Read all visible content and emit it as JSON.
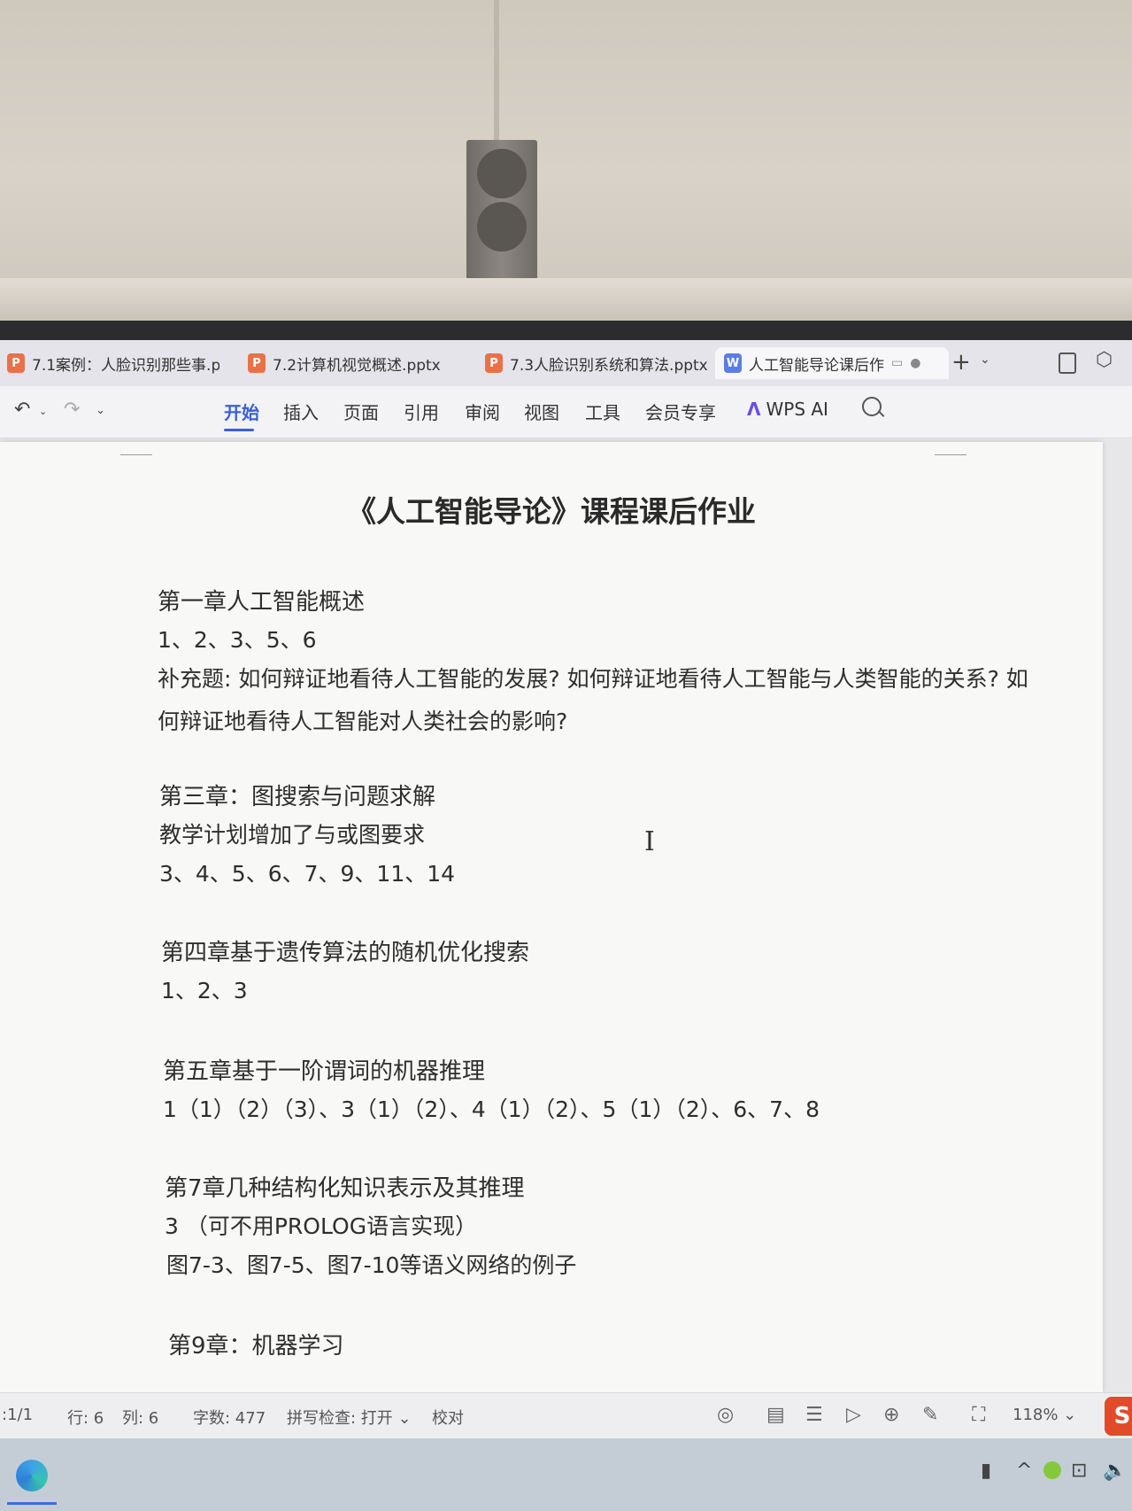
{
  "tabs": [
    {
      "badge": "P",
      "label": "7.1案例：人脸识别那些事.p"
    },
    {
      "badge": "P",
      "label": "7.2计算机视觉概述.pptx"
    },
    {
      "badge": "P",
      "label": "7.3人脸识别系统和算法.pptx"
    },
    {
      "badge": "W",
      "label": "人工智能导论课后作"
    }
  ],
  "tabbar": {
    "new_tab": "+",
    "menu_arrow": "⌄"
  },
  "ribbon": {
    "undo": "↶",
    "redo": "↷",
    "more": "⌄",
    "menus": [
      "开始",
      "插入",
      "页面",
      "引用",
      "审阅",
      "视图",
      "工具",
      "会员专享"
    ],
    "wps_ai": "WPS AI"
  },
  "document": {
    "title": "《人工智能导论》课程课后作业",
    "lines": [
      "第一章人工智能概述",
      "1、2、3、5、6",
      "补充题: 如何辩证地看待人工智能的发展? 如何辩证地看待人工智能与人类智能的关系? 如",
      "何辩证地看待人工智能对人类社会的影响?",
      "第三章：图搜索与问题求解",
      "教学计划增加了与或图要求",
      "3、4、5、6、7、9、11、14",
      "第四章基于遗传算法的随机优化搜索",
      "1、2、3",
      "第五章基于一阶谓词的机器推理",
      "1（1）（2）（3）、3（1）（2）、4（1）（2）、5（1）（2）、6、7、8",
      "第7章几种结构化知识表示及其推理",
      "3 （可不用PROLOG语言实现）",
      "图7-3、图7-5、图7-10等语义网络的例子",
      "第9章：机器学习"
    ]
  },
  "status": {
    "page": ":1/1",
    "row": "行: 6",
    "col": "列: 6",
    "words": "字数: 477",
    "spell": "拼写检查: 打开 ⌄",
    "proof": "校对",
    "zoom": "118% ⌄"
  },
  "icons": {
    "wps_brand_color": "#e14b2a",
    "accent": "#3a5fd8"
  }
}
